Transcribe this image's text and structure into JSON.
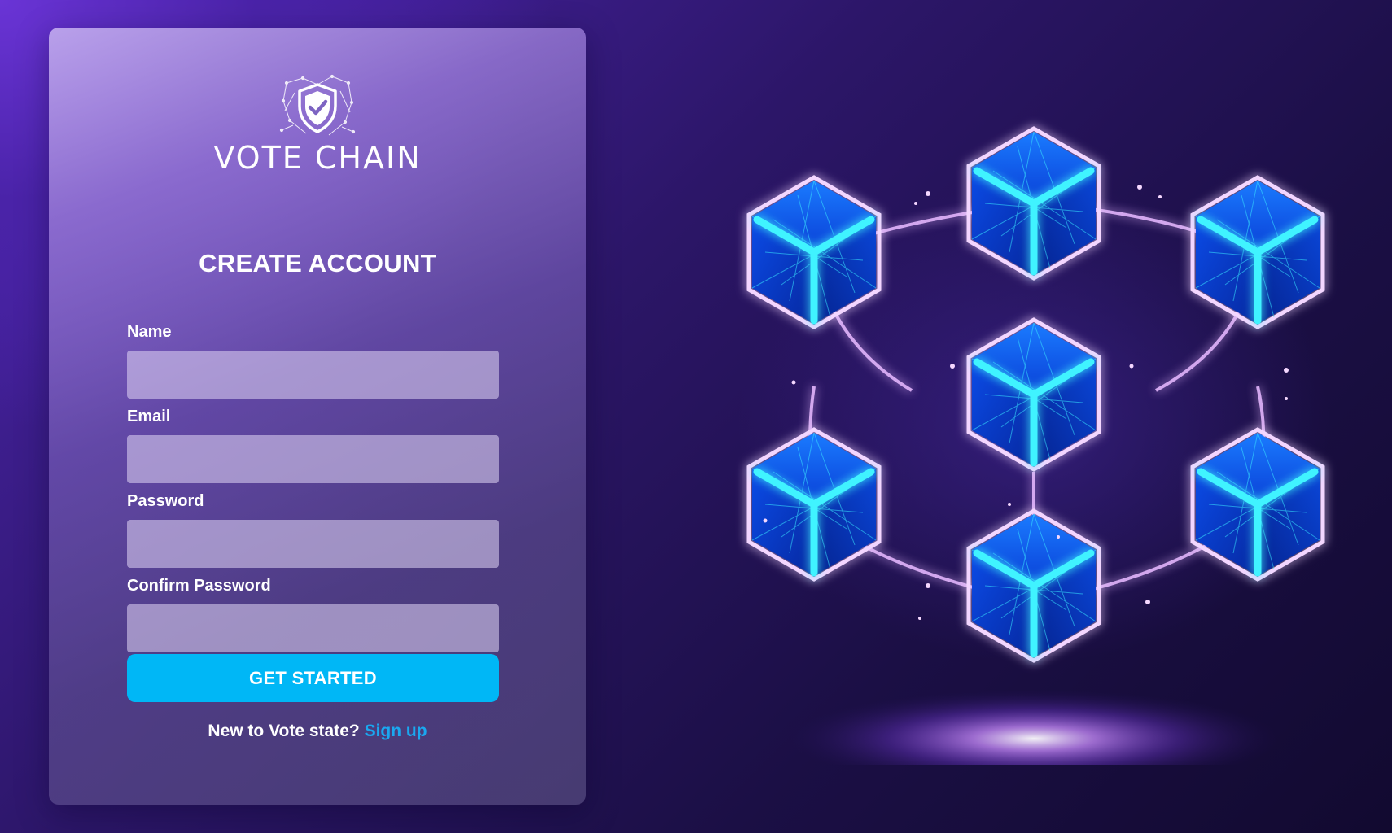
{
  "brand": {
    "name": "VOTE CHAIN",
    "logo_icon": "shield-check-icon"
  },
  "form": {
    "title": "CREATE ACCOUNT",
    "fields": [
      {
        "label": "Name",
        "value": "",
        "placeholder": ""
      },
      {
        "label": "Email",
        "value": "",
        "placeholder": ""
      },
      {
        "label": "Password",
        "value": "",
        "placeholder": ""
      },
      {
        "label": "Confirm Password",
        "value": "",
        "placeholder": ""
      }
    ],
    "submit_label": "GET STARTED",
    "footer_text": "New to Vote state?",
    "footer_link": "Sign up"
  },
  "colors": {
    "accent": "#00b7f6",
    "link": "#1aa8f0",
    "background": "#2c1668"
  },
  "illustration": {
    "icon": "blockchain-cubes-illustration"
  }
}
